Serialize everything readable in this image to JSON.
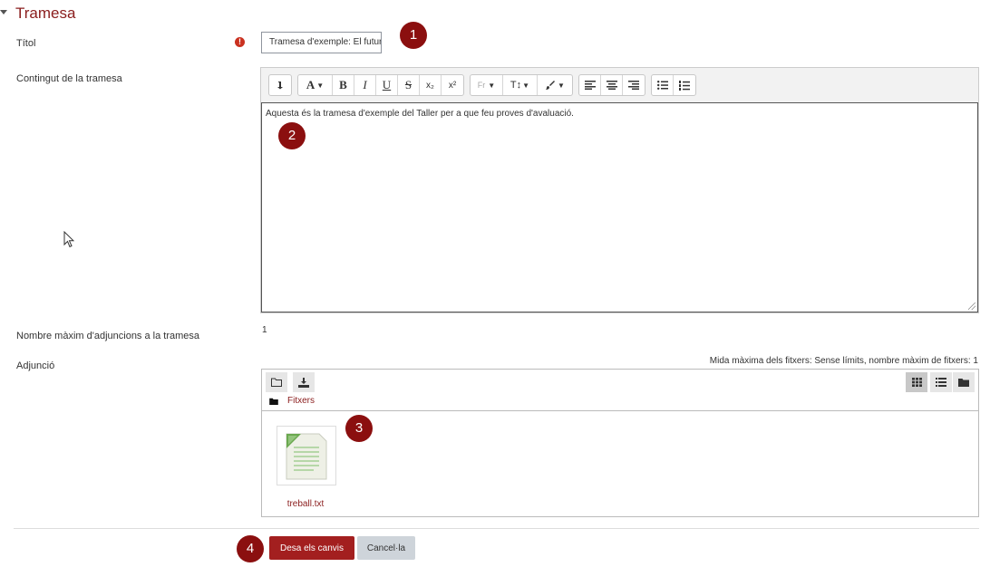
{
  "section": {
    "title": "Tramesa"
  },
  "fields": {
    "title_label": "Títol",
    "title_value": "Tramesa d'exemple: El futur",
    "content_label": "Contingut de la tramesa",
    "content_text": "Aquesta és la tramesa d'exemple del Taller per a que feu proves d'avaluació.",
    "max_attachments_label": "Nombre màxim d'adjuncions a la tramesa",
    "max_attachments_value": "1",
    "attachment_label": "Adjunció",
    "attachment_limits": "Mida màxima dels fitxers: Sense límits, nombre màxim de fitxers: 1"
  },
  "editor": {
    "toolbar": {
      "font_label": "A",
      "bold": "B",
      "italic": "I",
      "underline": "U",
      "strike": "S",
      "sub": "x₂",
      "sup": "x²",
      "font_family": "Fr",
      "font_size": "T↕"
    }
  },
  "filemanager": {
    "path_label": "Fitxers",
    "file_name": "treball.txt"
  },
  "buttons": {
    "save": "Desa els canvis",
    "cancel": "Cancel·la"
  },
  "badges": [
    "1",
    "2",
    "3",
    "4"
  ],
  "colors": {
    "brand": "#8a1c1c",
    "primary_button": "#a31f1f",
    "badge": "#8b0f0f",
    "required": "#ca3120"
  }
}
